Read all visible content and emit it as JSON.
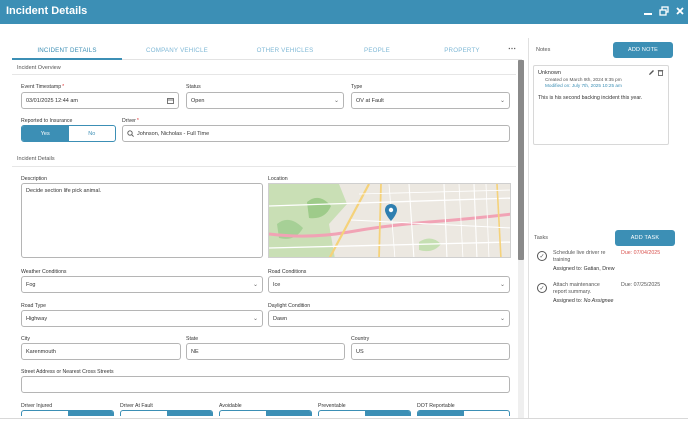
{
  "window": {
    "title": "Incident Details"
  },
  "tabs": [
    {
      "label": "INCIDENT DETAILS"
    },
    {
      "label": "COMPANY VEHICLE"
    },
    {
      "label": "OTHER VEHICLES"
    },
    {
      "label": "PEOPLE"
    },
    {
      "label": "PROPERTY"
    }
  ],
  "more_icon": "more-horizontal-icon",
  "overview": {
    "section_title": "Incident Overview",
    "event_timestamp": {
      "label": "Event Timestamp",
      "value": "03/01/2025 12:44 am"
    },
    "status": {
      "label": "Status",
      "value": "Open"
    },
    "type": {
      "label": "Type",
      "value": "OV at Fault"
    },
    "reported": {
      "label": "Reported to Insurance",
      "yes": "Yes",
      "no": "No",
      "selected": "Yes"
    },
    "driver": {
      "label": "Driver",
      "value": "Johnson, Nicholas - Full Time"
    }
  },
  "details": {
    "section_title": "Incident Details",
    "description": {
      "label": "Description",
      "value": "Decide section life pick animal."
    },
    "location": {
      "label": "Location"
    },
    "weather": {
      "label": "Weather Conditions",
      "value": "Fog"
    },
    "road_conditions": {
      "label": "Road Conditions",
      "value": "Ice"
    },
    "road_type": {
      "label": "Road Type",
      "value": "Highway"
    },
    "daylight": {
      "label": "Daylight Condition",
      "value": "Dawn"
    },
    "city": {
      "label": "City",
      "value": "Karenmouth"
    },
    "state": {
      "label": "State",
      "value": "NE"
    },
    "country": {
      "label": "Country",
      "value": "US"
    },
    "street": {
      "label": "Street Address or Nearest Cross Streets",
      "value": ""
    },
    "toggles": [
      {
        "label": "Driver Injured"
      },
      {
        "label": "Driver At Fault"
      },
      {
        "label": "Avoidable"
      },
      {
        "label": "Preventable"
      },
      {
        "label": "DOT Reportable"
      }
    ]
  },
  "notes": {
    "title": "Notes",
    "add_label": "ADD NOTE",
    "items": [
      {
        "author": "Unknown",
        "created": "Created on March 9th, 2024 9:35 pm",
        "modified": "Modified on: July 7th, 2025 10:25 am",
        "body": "This is his second backing incident this year."
      }
    ]
  },
  "tasks": {
    "title": "Tasks",
    "add_label": "ADD TASK",
    "items": [
      {
        "name": "Schedule live driver re training",
        "due": "Due: 07/04/2025",
        "due_color": "#d9534f",
        "assigned_label": "Assigned to:",
        "assignee": "Gatian, Drew"
      },
      {
        "name": "Attach maintenance report summary.",
        "due": "Due: 07/25/2025",
        "due_color": "#555555",
        "assigned_label": "Assigned to:",
        "assignee": "No Assignee"
      }
    ]
  },
  "colors": {
    "accent": "#3c8fb5",
    "danger": "#d9534f"
  }
}
